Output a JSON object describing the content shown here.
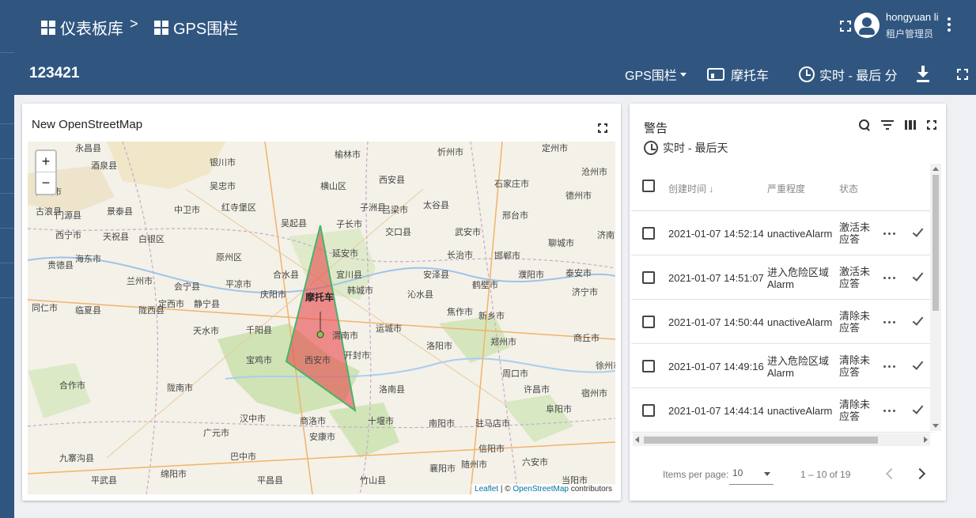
{
  "breadcrumb": {
    "root": "仪表板库",
    "separator": ">",
    "current": "GPS围栏"
  },
  "user": {
    "name": "hongyuan li",
    "role": "租户管理员"
  },
  "toolbar": {
    "dashboard_title": "123421",
    "state_select": "GPS围栏",
    "entity_label": "摩托车",
    "timewindow": "实时 - 最后 分"
  },
  "map_widget": {
    "title": "New OpenStreetMap",
    "zoom_in": "+",
    "zoom_out": "−",
    "attribution_leaflet": "Leaflet",
    "attribution_sep": " | © ",
    "attribution_osm": "OpenStreetMap",
    "attribution_tail": " contributors",
    "marker_label": "摩托车",
    "fence_color": "#e8474b",
    "labels": [
      "永昌县",
      "酒泉县",
      "银川市",
      "榆林市",
      "忻州市",
      "定州市",
      "灵武市",
      "吴忠市",
      "横山区",
      "西安县",
      "石家庄市",
      "沧州市",
      "古浪县",
      "景泰县",
      "中卫市",
      "子洲县",
      "吕梁市",
      "太谷县",
      "邢台市",
      "德州市",
      "济南市",
      "门源县",
      "红寺堡区",
      "吴起县",
      "子长市",
      "交口县",
      "武安市",
      "聊城市",
      "西宁市",
      "天祝县",
      "白银区",
      "原州区",
      "延安市",
      "长治市",
      "邯郸市",
      "泰安市",
      "海东市",
      "兰州市",
      "平凉市",
      "合水县",
      "宜川县",
      "安泽县",
      "濮阳市",
      "贵德县",
      "会宁县",
      "庆阳市",
      "韩城市",
      "鹤壁市",
      "定西市",
      "静宁县",
      "沁水县",
      "新乡市",
      "济宁市",
      "同仁市",
      "临夏县",
      "陇西县",
      "天水市",
      "千阳县",
      "运城市",
      "焦作市",
      "洛阳市",
      "郑州市",
      "商丘市",
      "宝鸡市",
      "西安市",
      "渭南市",
      "开封市",
      "周口市",
      "徐州市",
      "合作市",
      "洛南县",
      "许昌市",
      "宿州市",
      "陇南市",
      "汉中市",
      "商洛市",
      "十堰市",
      "南阳市",
      "驻马店市",
      "阜阳市",
      "广元市",
      "安康市",
      "襄阳市",
      "信阳市",
      "巴中市",
      "绵阳市",
      "随州市",
      "六安市",
      "九寨沟县",
      "平武县",
      "平昌县",
      "竹山县",
      "当阳市"
    ]
  },
  "alarm_widget": {
    "title": "警告",
    "timewindow": "实时 - 最后天",
    "columns": [
      "创建时间",
      "严重程度",
      "状态"
    ],
    "sort_arrow": "↓",
    "rows": [
      {
        "time": "2021-01-07 14:52:14",
        "type_line1": "unactiveAlarm",
        "type_line2": "",
        "status_line1": "激活未",
        "status_line2": "应答"
      },
      {
        "time": "2021-01-07 14:51:07",
        "type_line1": "进入危险区域",
        "type_line2": "Alarm",
        "status_line1": "激活未",
        "status_line2": "应答"
      },
      {
        "time": "2021-01-07 14:50:44",
        "type_line1": "unactiveAlarm",
        "type_line2": "",
        "status_line1": "清除未",
        "status_line2": "应答"
      },
      {
        "time": "2021-01-07 14:49:16",
        "type_line1": "进入危险区域",
        "type_line2": "Alarm",
        "status_line1": "清除未",
        "status_line2": "应答"
      },
      {
        "time": "2021-01-07 14:44:14",
        "type_line1": "unactiveAlarm",
        "type_line2": "",
        "status_line1": "清除未",
        "status_line2": "应答"
      }
    ],
    "pager": {
      "items_per_page_label": "Items per page:",
      "page_size": "10",
      "range": "1 – 10 of 19"
    }
  }
}
